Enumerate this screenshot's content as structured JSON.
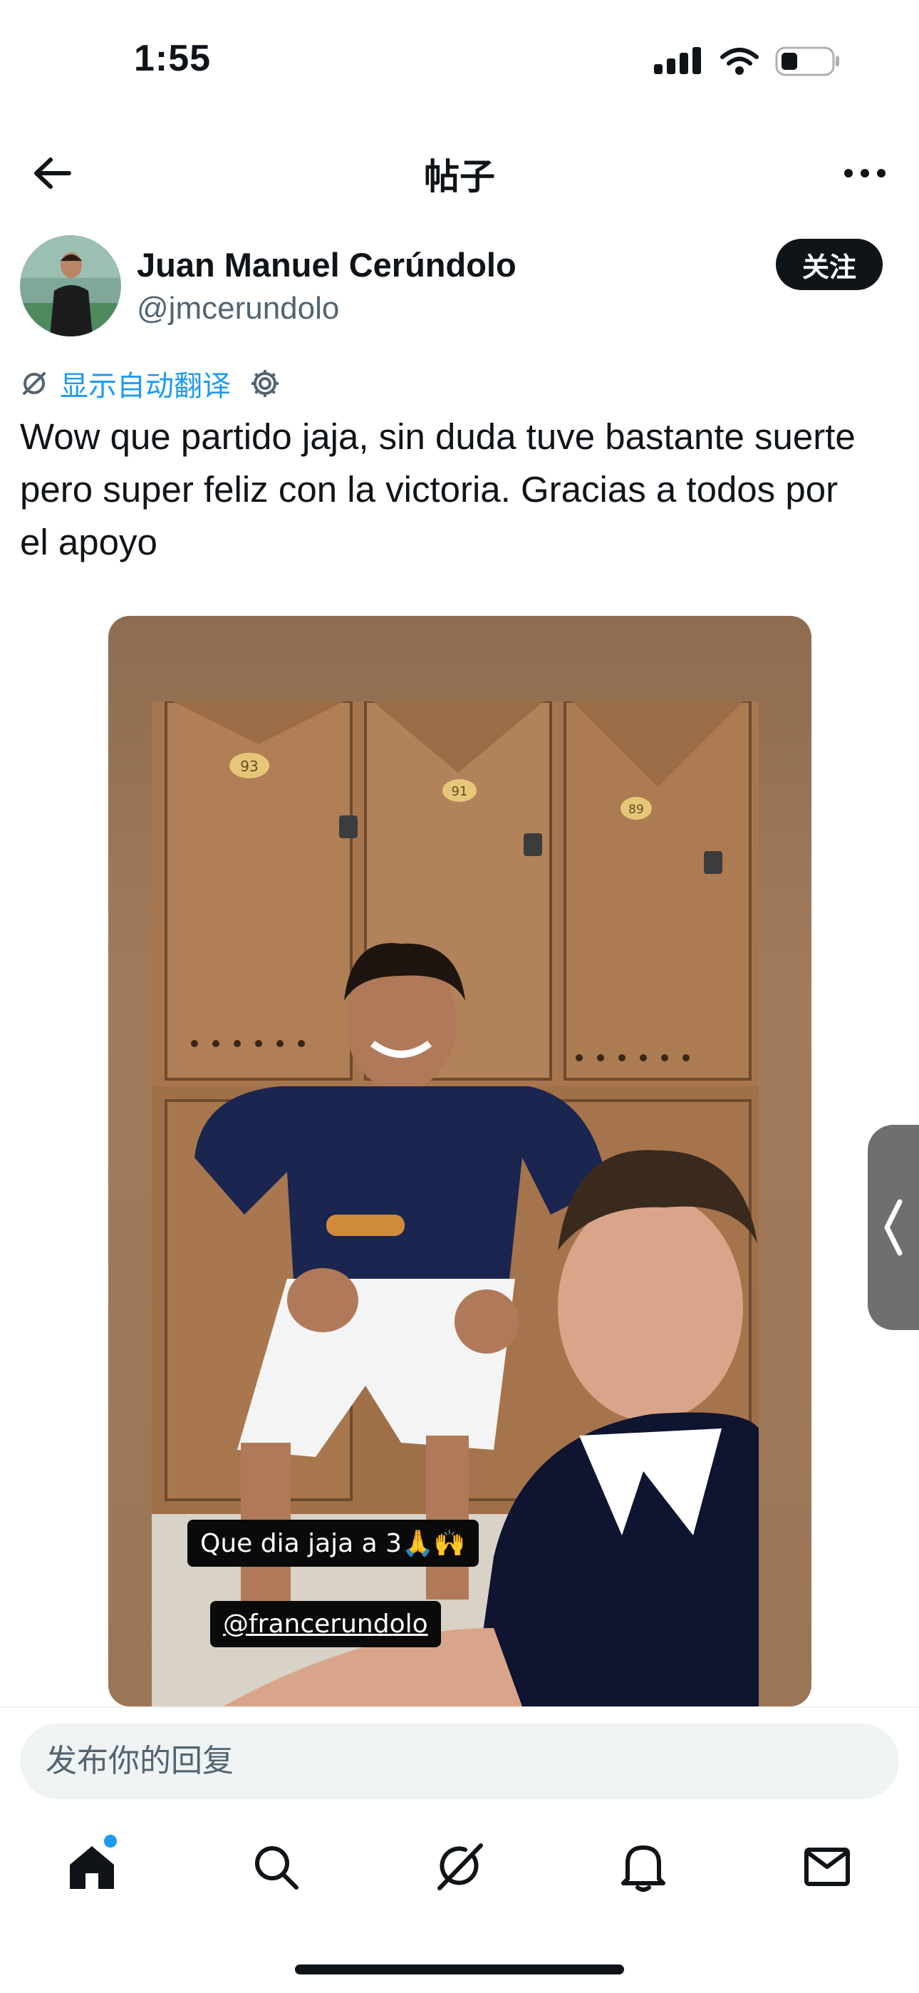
{
  "status_bar": {
    "time": "1:55",
    "icons": [
      "signal-icon",
      "wifi-icon",
      "battery-icon"
    ]
  },
  "header": {
    "title": "帖子",
    "back_icon": "back-arrow-icon",
    "more_icon": "more-dots-icon"
  },
  "post": {
    "author": {
      "name": "Juan Manuel Cerúndolo",
      "handle": "@jmcerundolo",
      "avatar_icon": "avatar"
    },
    "follow_label": "关注",
    "translate_label": "显示自动翻译",
    "text": "Wow que partido jaja, sin duda tuve bastante suerte pero super feliz con la victoria. Gracias a todos por el apoyo",
    "media": {
      "caption_1": "Que dia jaja a 3🙏🙌",
      "caption_2": "@francerundolo",
      "locker_numbers": [
        "93",
        "91",
        "89"
      ]
    }
  },
  "reply": {
    "placeholder": "发布你的回复"
  },
  "nav": {
    "items": [
      "home-icon",
      "search-icon",
      "grok-icon",
      "notifications-icon",
      "messages-icon"
    ],
    "home_has_badge": true
  },
  "colors": {
    "accent": "#1d9bf0",
    "text": "#0f1419",
    "muted": "#536471",
    "media_bg": "#9a7556"
  }
}
